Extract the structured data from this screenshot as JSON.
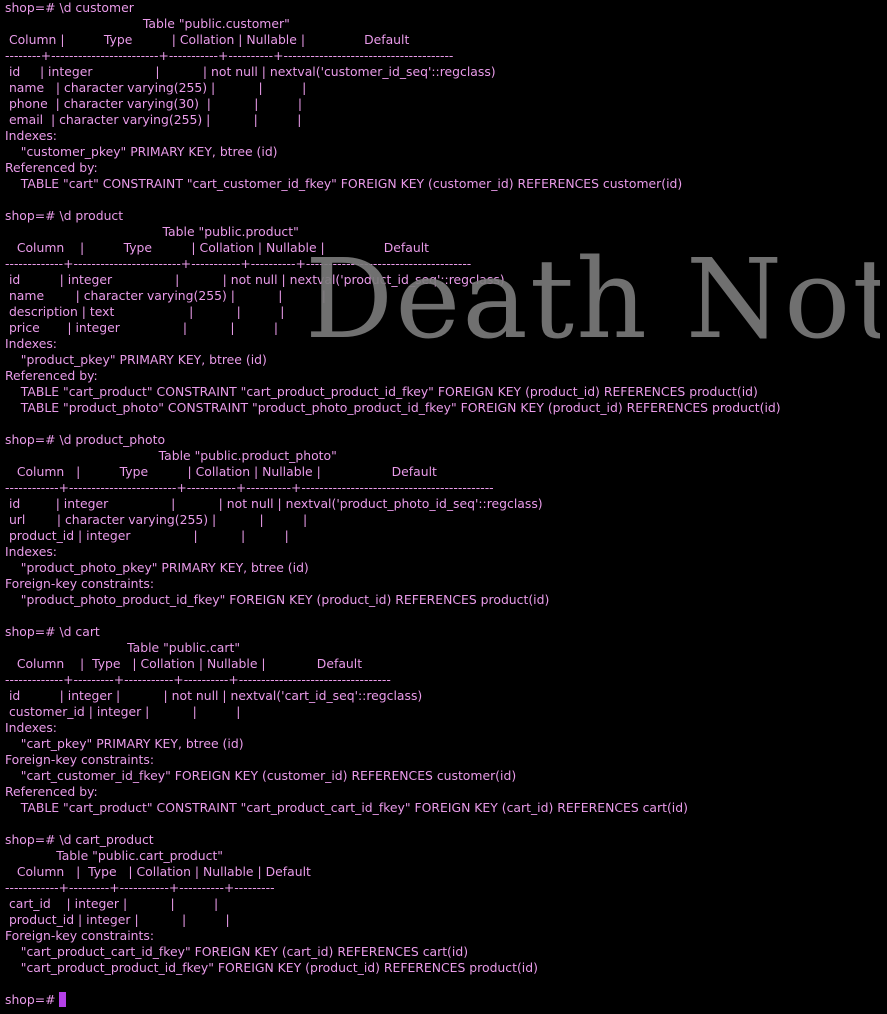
{
  "terminal": {
    "lines": [
      "shop=# \\d customer",
      "                                   Table \"public.customer\"",
      " Column |          Type          | Collation | Nullable |               Default",
      "--------+------------------------+-----------+----------+--------------------------------------",
      " id     | integer                |           | not null | nextval('customer_id_seq'::regclass)",
      " name   | character varying(255) |           |          |",
      " phone  | character varying(30)  |           |          |",
      " email  | character varying(255) |           |          |",
      "Indexes:",
      "    \"customer_pkey\" PRIMARY KEY, btree (id)",
      "Referenced by:",
      "    TABLE \"cart\" CONSTRAINT \"cart_customer_id_fkey\" FOREIGN KEY (customer_id) REFERENCES customer(id)",
      "",
      "shop=# \\d product",
      "                                        Table \"public.product\"",
      "   Column    |          Type          | Collation | Nullable |               Default",
      "-------------+------------------------+-----------+----------+-------------------------------------",
      " id          | integer                |           | not null | nextval('product_id_seq'::regclass)",
      " name        | character varying(255) |           |          |",
      " description | text                   |           |          |",
      " price       | integer                |           |          |",
      "Indexes:",
      "    \"product_pkey\" PRIMARY KEY, btree (id)",
      "Referenced by:",
      "    TABLE \"cart_product\" CONSTRAINT \"cart_product_product_id_fkey\" FOREIGN KEY (product_id) REFERENCES product(id)",
      "    TABLE \"product_photo\" CONSTRAINT \"product_photo_product_id_fkey\" FOREIGN KEY (product_id) REFERENCES product(id)",
      "",
      "shop=# \\d product_photo",
      "                                       Table \"public.product_photo\"",
      "   Column   |          Type          | Collation | Nullable |                  Default",
      "------------+------------------------+-----------+----------+-------------------------------------------",
      " id         | integer                |           | not null | nextval('product_photo_id_seq'::regclass)",
      " url        | character varying(255) |           |          |",
      " product_id | integer                |           |          |",
      "Indexes:",
      "    \"product_photo_pkey\" PRIMARY KEY, btree (id)",
      "Foreign-key constraints:",
      "    \"product_photo_product_id_fkey\" FOREIGN KEY (product_id) REFERENCES product(id)",
      "",
      "shop=# \\d cart",
      "                               Table \"public.cart\"",
      "   Column    |  Type   | Collation | Nullable |             Default",
      "-------------+---------+-----------+----------+----------------------------------",
      " id          | integer |           | not null | nextval('cart_id_seq'::regclass)",
      " customer_id | integer |           |          |",
      "Indexes:",
      "    \"cart_pkey\" PRIMARY KEY, btree (id)",
      "Foreign-key constraints:",
      "    \"cart_customer_id_fkey\" FOREIGN KEY (customer_id) REFERENCES customer(id)",
      "Referenced by:",
      "    TABLE \"cart_product\" CONSTRAINT \"cart_product_cart_id_fkey\" FOREIGN KEY (cart_id) REFERENCES cart(id)",
      "",
      "shop=# \\d cart_product",
      "             Table \"public.cart_product\"",
      "   Column   |  Type   | Collation | Nullable | Default",
      "------------+---------+-----------+----------+---------",
      " cart_id    | integer |           |          |",
      " product_id | integer |           |          |",
      "Foreign-key constraints:",
      "    \"cart_product_cart_id_fkey\" FOREIGN KEY (cart_id) REFERENCES cart(id)",
      "    \"cart_product_product_id_fkey\" FOREIGN KEY (product_id) REFERENCES product(id)",
      ""
    ],
    "prompt": "shop=# ",
    "text_color": "#ea9bea",
    "background_color": "#000000",
    "cursor_color": "#b540e8"
  },
  "watermark": {
    "text": "Death Note",
    "color": "#7a7a7a"
  }
}
